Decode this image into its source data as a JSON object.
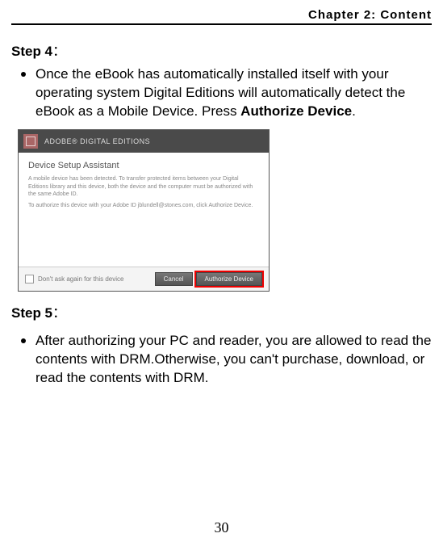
{
  "chapter": "Chapter 2: Content",
  "step4": {
    "title": "Step 4",
    "colon": "：",
    "text_before": "Once the eBook has automatically installed itself with your operating system Digital Editions will automatically detect the eBook as a Mobile Device. Press ",
    "bold": "Authorize Device",
    "text_after": "."
  },
  "dialog": {
    "app_title": "ADOBE® DIGITAL EDITIONS",
    "heading": "Device Setup Assistant",
    "line1": "A mobile device has been detected. To transfer protected items between your Digital Editions library and this device, both the device and the computer must be authorized with the same Adobe ID.",
    "line2": "To authorize this device with your Adobe ID jblundell@stones.com, click Authorize Device.",
    "checkbox_label": "Don't ask again for this device",
    "cancel": "Cancel",
    "authorize": "Authorize Device"
  },
  "step5": {
    "title": "Step 5",
    "colon": "：",
    "text": "After authorizing your PC and reader, you are allowed to read the contents with DRM.Otherwise, you can't purchase, download, or read the contents with DRM."
  },
  "page_number": "30"
}
